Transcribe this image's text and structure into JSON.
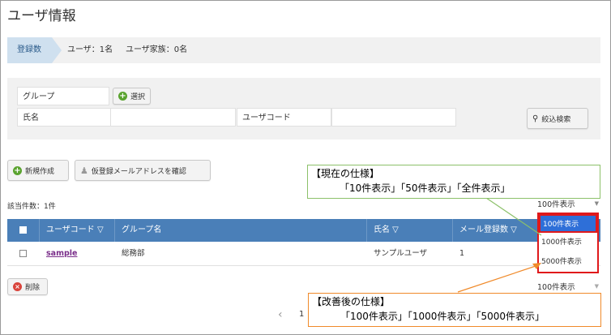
{
  "page": {
    "title": "ユーザ情報"
  },
  "summary": {
    "tab_label": "登録数",
    "users": "ユーザ：1名",
    "family": "ユーザ家族：0名"
  },
  "search": {
    "group_label": "グループ",
    "select_button": "選択",
    "name_label": "氏名",
    "name_value": "",
    "user_code_label": "ユーザコード",
    "user_code_value": "",
    "filter_button": "絞込検索"
  },
  "actions": {
    "new_button": "新規作成",
    "confirm_mail_button": "仮登録メールアドレスを確認"
  },
  "results": {
    "count_text": "該当件数：1件"
  },
  "page_size_selector": {
    "current": "100件表示",
    "options": [
      "100件表示",
      "1000件表示",
      "5000件表示"
    ]
  },
  "table": {
    "columns": [
      "ユーザコード ▽",
      "グループ名",
      "氏名 ▽",
      "メール登録数 ▽"
    ],
    "rows": [
      {
        "user_code": "sample",
        "group": "総務部",
        "name": "サンプルユーザ",
        "mail_count": "1"
      }
    ]
  },
  "bottom": {
    "delete_button": "削除",
    "page_size_value": "100件表示"
  },
  "pagination": {
    "prev_icon": "‹",
    "page": "1"
  },
  "callouts": {
    "current": {
      "title": "【現在の仕様】",
      "body": "「10件表示」「50件表示」「全件表示」",
      "border_color": "#8cc16a"
    },
    "improved": {
      "title": "【改善後の仕様】",
      "body": "「100件表示」「1000件表示」「5000件表示」",
      "border_color": "#f08a2a"
    }
  },
  "colors": {
    "table_header": "#4a7fb8",
    "summary_tab": "#cfe0ef",
    "highlight": "#e0191b",
    "selected_option": "#2e6fd8"
  }
}
